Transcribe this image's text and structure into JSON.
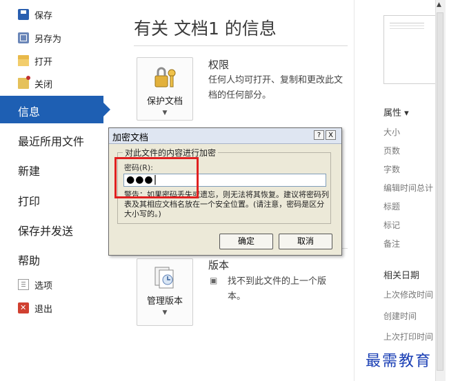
{
  "sidebar": {
    "small_items_top": [
      {
        "label": "保存",
        "icon": "save-icon"
      },
      {
        "label": "另存为",
        "icon": "save-as-icon"
      },
      {
        "label": "打开",
        "icon": "open-folder-icon"
      },
      {
        "label": "关闭",
        "icon": "close-file-icon"
      }
    ],
    "active": "信息",
    "big_items": [
      "最近所用文件",
      "新建",
      "打印",
      "保存并发送",
      "帮助"
    ],
    "small_items_bottom": [
      {
        "label": "选项",
        "icon": "options-icon"
      },
      {
        "label": "退出",
        "icon": "exit-icon"
      }
    ]
  },
  "main": {
    "title": "有关 文档1 的信息",
    "permissions": {
      "button_label": "保护文档",
      "heading": "权限",
      "description": "任何人均可打开、复制和更改此文档的任何部分。"
    },
    "versions": {
      "button_label": "管理版本",
      "heading": "版本",
      "description": "找不到此文件的上一个版本。"
    }
  },
  "properties": {
    "heading": "属性 ▾",
    "items": [
      "大小",
      "页数",
      "字数",
      "编辑时间总计",
      "标题",
      "标记",
      "备注"
    ],
    "dates_heading": "相关日期",
    "dates": [
      "上次修改时间",
      "创建时间",
      "上次打印时间"
    ]
  },
  "dialog": {
    "title": "加密文档",
    "help_button": "?",
    "close_button": "X",
    "group_label": "对此文件的内容进行加密",
    "password_label": "密码(R):",
    "password_value": "●●●|",
    "warning": "警告：如果密码丢失或遗忘，则无法将其恢复。建议将密码列表及其相应文档名放在一个安全位置。(请注意，密码是区分大小写的。)",
    "ok_button": "确定",
    "cancel_button": "取消"
  },
  "watermark": "最需教育",
  "colors": {
    "nav_active": "#1e5fb3",
    "highlight": "#e02020",
    "watermark": "#1a3fb5"
  }
}
